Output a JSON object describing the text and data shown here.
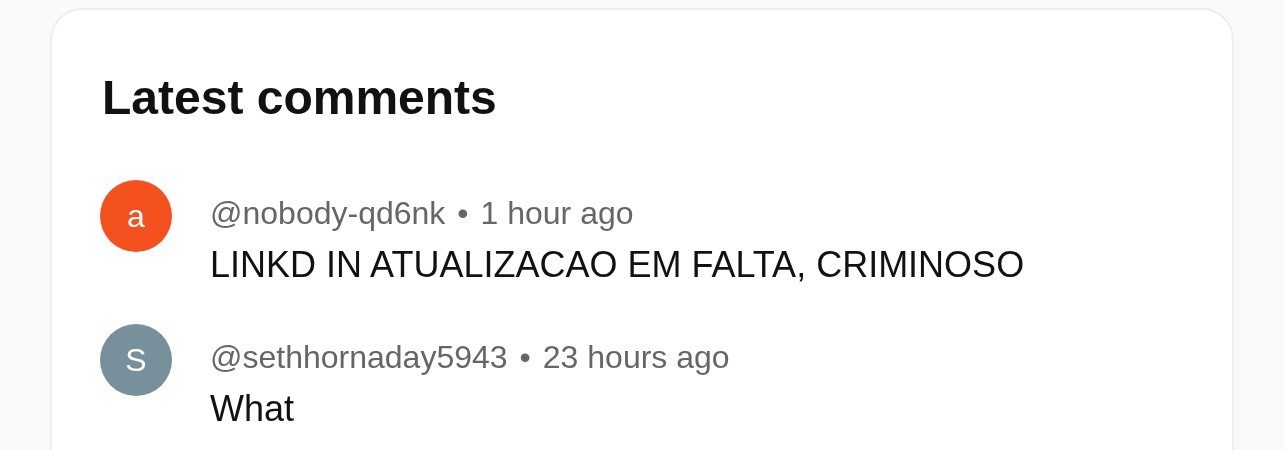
{
  "card": {
    "title": "Latest comments",
    "comments": [
      {
        "avatar": "a",
        "color": "#f4511e",
        "author": "@nobody-qd6nk",
        "separator": "•",
        "time": "1 hour ago",
        "text": "LINKD IN ATUALIZACAO EM FALTA, CRIMINOSO"
      },
      {
        "avatar": "S",
        "color": "#78909c",
        "author": "@sethhornaday5943",
        "separator": "•",
        "time": "23 hours ago",
        "text": "What"
      }
    ]
  }
}
